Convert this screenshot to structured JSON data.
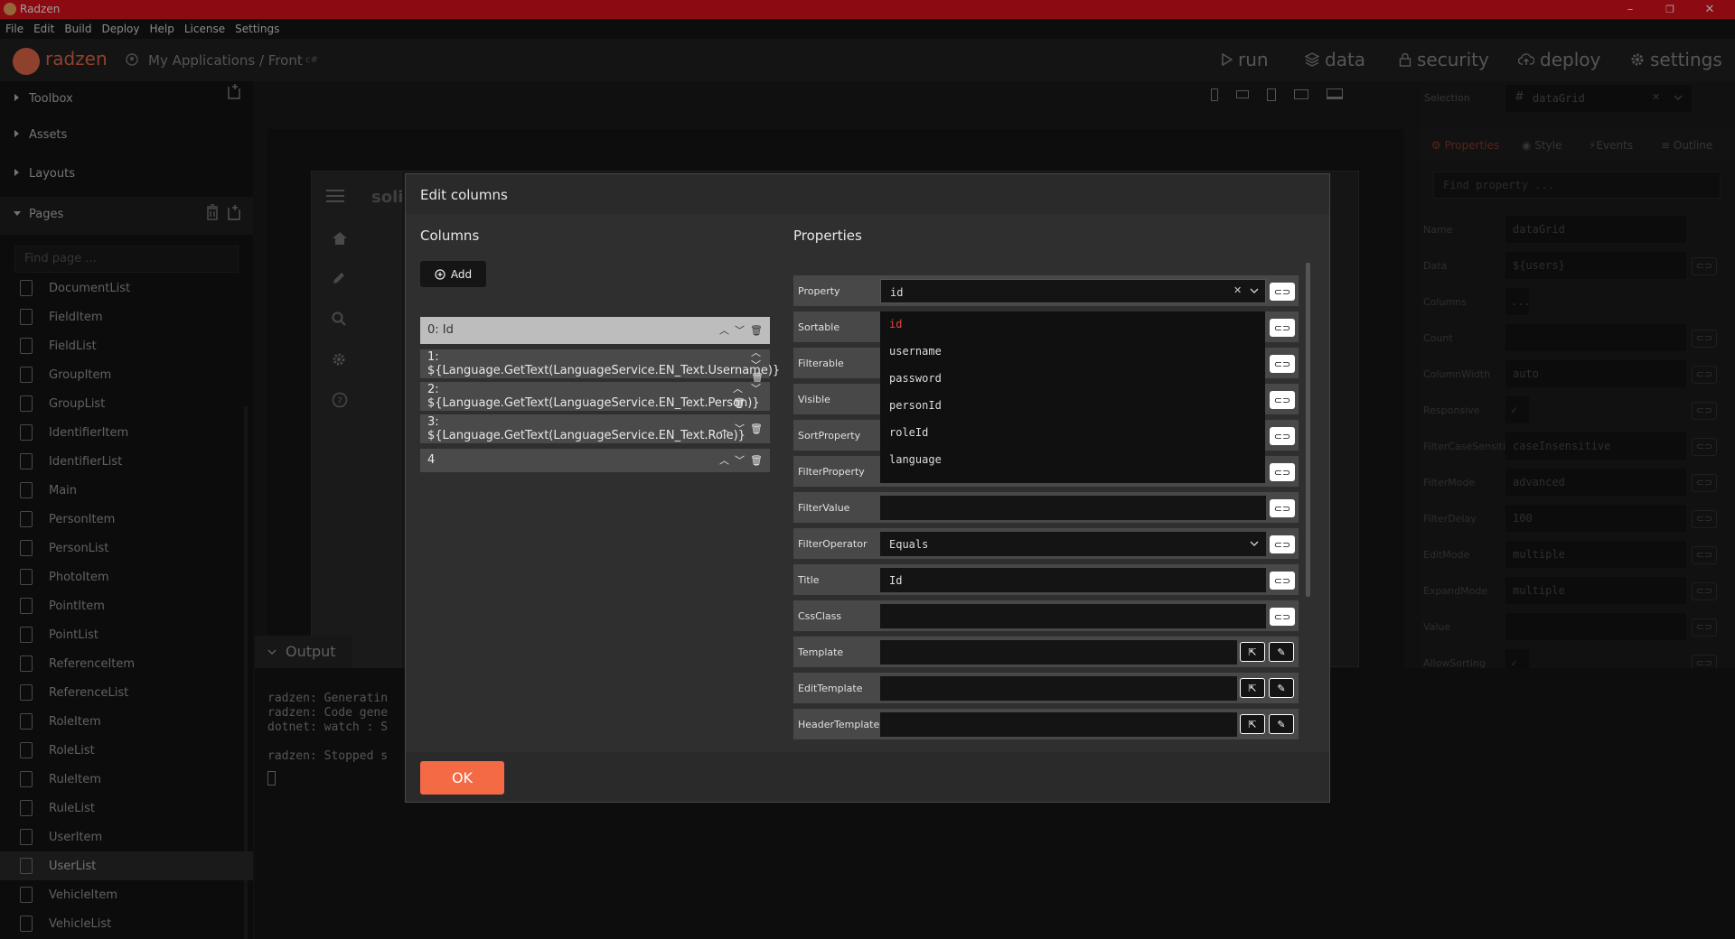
{
  "window": {
    "title": "Radzen",
    "minimize": "–",
    "restore": "❐",
    "close": "✕"
  },
  "menu": [
    "File",
    "Edit",
    "Build",
    "Deploy",
    "Help",
    "License",
    "Settings"
  ],
  "header": {
    "brand": "radzen",
    "breadcrumb": "My Applications / Front",
    "lang_badge": "c#",
    "nav": {
      "run": "run",
      "data": "data",
      "security": "security",
      "deploy": "deploy",
      "settings": "settings"
    }
  },
  "sidebar": {
    "sections": {
      "toolbox": "Toolbox",
      "assets": "Assets",
      "layouts": "Layouts",
      "pages": "Pages"
    },
    "find_placeholder": "Find page ...",
    "pages": [
      "DocumentList",
      "FieldItem",
      "FieldList",
      "GroupItem",
      "GroupList",
      "IdentifierItem",
      "IdentifierList",
      "Main",
      "PersonItem",
      "PersonList",
      "PhotoItem",
      "PointItem",
      "PointList",
      "ReferenceItem",
      "ReferenceList",
      "RoleItem",
      "RoleList",
      "RuleItem",
      "RuleList",
      "UserItem",
      "UserList",
      "VehicleItem",
      "VehicleList"
    ],
    "active_page": "UserList"
  },
  "canvas": {
    "logo_text": "soli"
  },
  "right_panel": {
    "selection_label": "Selection",
    "selection_value": "dataGrid",
    "tabs": {
      "properties": "Properties",
      "style": "Style",
      "events": "Events",
      "outline": "Outline"
    },
    "find_placeholder": "Find property ...",
    "rows": [
      {
        "label": "Name",
        "value": "dataGrid"
      },
      {
        "label": "Data",
        "value": "${users}"
      },
      {
        "label": "Columns",
        "value": "..."
      },
      {
        "label": "Count",
        "value": ""
      },
      {
        "label": "ColumnWidth",
        "value": "auto"
      },
      {
        "label": "Responsive",
        "value": "✓"
      },
      {
        "label": "FilterCaseSensiti...",
        "value": "caseInsensitive"
      },
      {
        "label": "FilterMode",
        "value": "advanced"
      },
      {
        "label": "FilterDelay",
        "value": "100"
      },
      {
        "label": "EditMode",
        "value": "multiple"
      },
      {
        "label": "ExpandMode",
        "value": "multiple"
      },
      {
        "label": "Value",
        "value": ""
      },
      {
        "label": "AllowSorting",
        "value": "✓"
      }
    ]
  },
  "output": {
    "tab": "Output",
    "lines": [
      "radzen: Generatin",
      "radzen: Code gene",
      "dotnet: watch : S",
      "",
      "radzen: Stopped s"
    ]
  },
  "dialog": {
    "title": "Edit columns",
    "columns_title": "Columns",
    "properties_title": "Properties",
    "add_label": "Add",
    "columns": [
      {
        "index": "0: Id",
        "text": ""
      },
      {
        "index": "1:",
        "text": "${Language.GetText(LanguageService.EN_Text.Username)}"
      },
      {
        "index": "2:",
        "text": "${Language.GetText(LanguageService.EN_Text.Person)}"
      },
      {
        "index": "3:",
        "text": "${Language.GetText(LanguageService.EN_Text.Role)}"
      },
      {
        "index": "4",
        "text": ""
      }
    ],
    "properties": {
      "property": {
        "label": "Property",
        "value": "id"
      },
      "sortable": {
        "label": "Sortable"
      },
      "filterable": {
        "label": "Filterable"
      },
      "visible": {
        "label": "Visible"
      },
      "sortproperty": {
        "label": "SortProperty"
      },
      "filterproperty": {
        "label": "FilterProperty"
      },
      "filtervalue": {
        "label": "FilterValue"
      },
      "filteroperator": {
        "label": "FilterOperator",
        "value": "Equals"
      },
      "title": {
        "label": "Title",
        "value": "Id"
      },
      "cssclass": {
        "label": "CssClass"
      },
      "template": {
        "label": "Template"
      },
      "edittemplate": {
        "label": "EditTemplate"
      },
      "headertemplate": {
        "label": "HeaderTemplate"
      }
    },
    "dropdown_options": [
      "id",
      "username",
      "password",
      "personId",
      "roleId",
      "language"
    ],
    "ok_label": "OK"
  },
  "colors": {
    "titlebar": "#e3131e",
    "ok_button": "#f46a45",
    "brand": "#e86a4b",
    "selected_option": "#e0463a"
  }
}
